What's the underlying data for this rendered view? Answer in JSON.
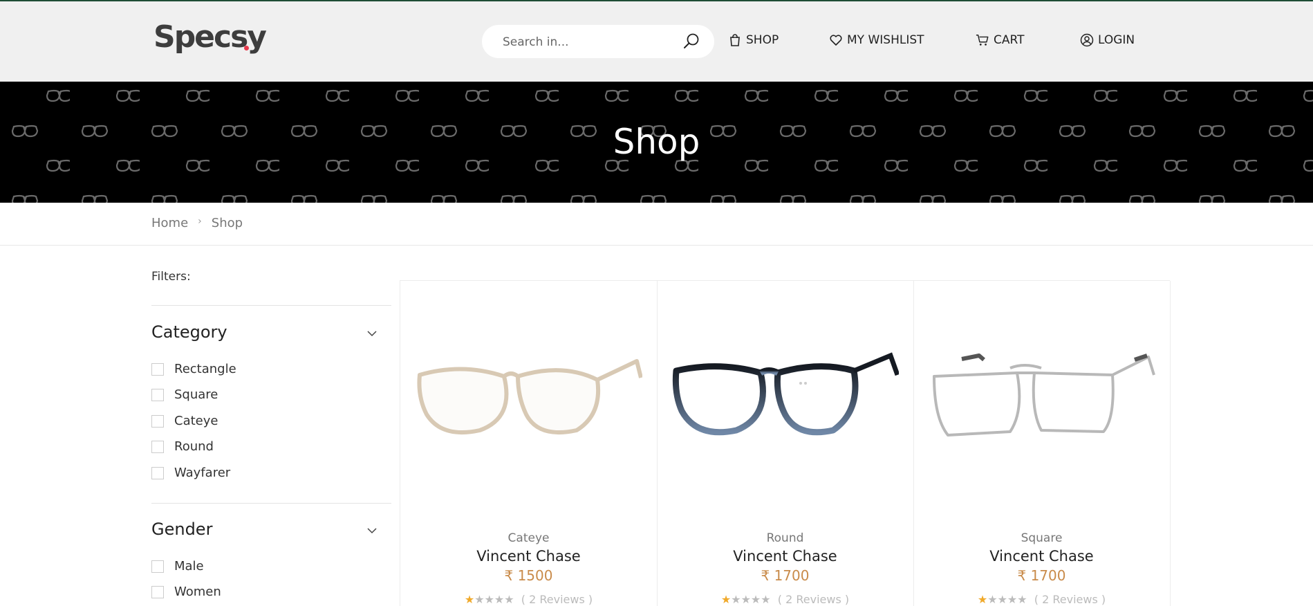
{
  "brand": {
    "logo_text": "Specsy"
  },
  "search": {
    "placeholder": "Search in..."
  },
  "nav": [
    {
      "label": "SHOP",
      "icon": "bag-icon"
    },
    {
      "label": "MY WISHLIST",
      "icon": "heart-icon"
    },
    {
      "label": "CART",
      "icon": "cart-icon"
    },
    {
      "label": "LOGIN",
      "icon": "user-icon"
    }
  ],
  "hero": {
    "title": "Shop"
  },
  "breadcrumb": {
    "home": "Home",
    "separator": "›",
    "current": "Shop"
  },
  "filters": {
    "label": "Filters:",
    "groups": [
      {
        "title": "Category",
        "options": [
          "Rectangle",
          "Square",
          "Cateye",
          "Round",
          "Wayfarer"
        ]
      },
      {
        "title": "Gender",
        "options": [
          "Male",
          "Women"
        ]
      }
    ]
  },
  "products": [
    {
      "category": "Cateye",
      "name": "Vincent Chase",
      "price": "₹ 1500",
      "rating": 1,
      "reviews": "( 2 Reviews )",
      "frame_color": "#d8c9b4"
    },
    {
      "category": "Round",
      "name": "Vincent Chase",
      "price": "₹ 1700",
      "rating": 1,
      "reviews": "( 2 Reviews )",
      "frame_color": "#1e2533"
    },
    {
      "category": "Square",
      "name": "Vincent Chase",
      "price": "₹ 1700",
      "rating": 1,
      "reviews": "( 2 Reviews )",
      "frame_color": "#b8b8b8"
    }
  ],
  "colors": {
    "accent_price": "#c98b4a",
    "hero_bg": "#000000",
    "header_bg": "#f0f0f0",
    "logo_dot": "#e8394d",
    "star": "#f0a92a"
  }
}
